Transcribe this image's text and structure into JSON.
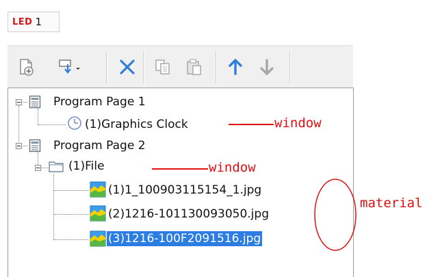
{
  "led": {
    "tag": "LED",
    "number": "1"
  },
  "toolbar": {
    "icons": [
      "new-page-icon",
      "add-window-dropdown-icon",
      "delete-icon",
      "copy-icon",
      "paste-icon",
      "move-up-icon",
      "move-down-icon"
    ]
  },
  "tree": {
    "nodes": [
      {
        "label": "Program Page 1",
        "icon": "program-page-icon"
      },
      {
        "label": "(1)Graphics Clock",
        "icon": "clock-icon"
      },
      {
        "label": "Program Page 2",
        "icon": "program-page-icon"
      },
      {
        "label": "(1)File",
        "icon": "folder-icon"
      },
      {
        "label": "(1)1_100903115154_1.jpg",
        "icon": "image-icon"
      },
      {
        "label": "(2)1216-101130093050.jpg",
        "icon": "image-icon"
      },
      {
        "label": "(3)1216-100F2091516.jpg",
        "icon": "image-icon",
        "selected": true
      }
    ]
  },
  "annotations": {
    "window_1": "window",
    "window_2": "window",
    "material": "material"
  },
  "colors": {
    "selection": "#2b7de1",
    "annotation": "#e01010",
    "led_tag": "#d01818",
    "toolbar_icon_blue": "#2f7fd6"
  }
}
